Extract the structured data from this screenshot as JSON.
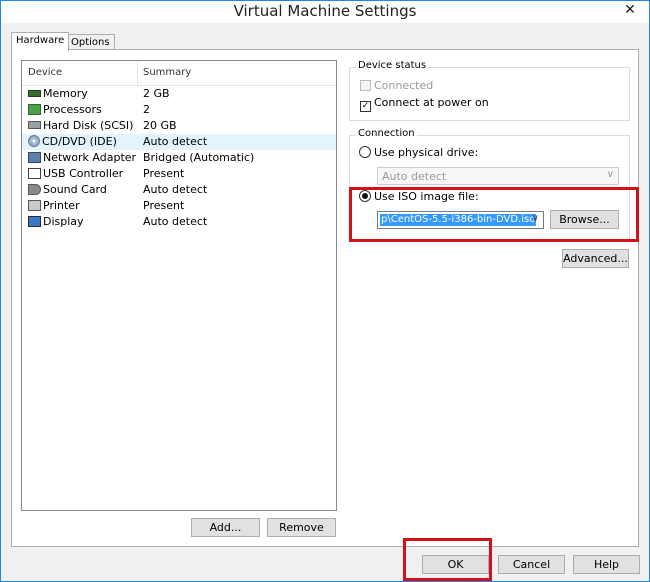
{
  "window": {
    "title": "Virtual Machine Settings",
    "close_glyph": "✕"
  },
  "tabs": [
    {
      "label": "Hardware"
    },
    {
      "label": "Options"
    }
  ],
  "device_list": {
    "columns": {
      "device": "Device",
      "summary": "Summary"
    },
    "rows": [
      {
        "icon": "memory-icon",
        "device": "Memory",
        "summary": "2 GB"
      },
      {
        "icon": "processor-icon",
        "device": "Processors",
        "summary": "2"
      },
      {
        "icon": "hard-disk-icon",
        "device": "Hard Disk (SCSI)",
        "summary": "20 GB"
      },
      {
        "icon": "cd-dvd-icon",
        "device": "CD/DVD (IDE)",
        "summary": "Auto detect",
        "selected": true
      },
      {
        "icon": "network-adapter-icon",
        "device": "Network Adapter",
        "summary": "Bridged (Automatic)"
      },
      {
        "icon": "usb-controller-icon",
        "device": "USB Controller",
        "summary": "Present"
      },
      {
        "icon": "sound-card-icon",
        "device": "Sound Card",
        "summary": "Auto detect"
      },
      {
        "icon": "printer-icon",
        "device": "Printer",
        "summary": "Present"
      },
      {
        "icon": "display-icon",
        "device": "Display",
        "summary": "Auto detect"
      }
    ]
  },
  "list_buttons": {
    "add": "Add...",
    "remove": "Remove"
  },
  "device_status": {
    "title": "Device status",
    "connected": {
      "label": "Connected",
      "checked": false,
      "enabled": false
    },
    "connect_at_power_on": {
      "label": "Connect at power on",
      "checked": true,
      "check_glyph": "✓"
    }
  },
  "connection": {
    "title": "Connection",
    "physical_drive": {
      "label": "Use physical drive:",
      "selected": false
    },
    "physical_drive_select": {
      "value": "Auto detect",
      "arrow": "∨"
    },
    "iso_image": {
      "label": "Use ISO image file:",
      "selected": true
    },
    "iso_path": {
      "value": "p\\CentOS-5.5-i386-bin-DVD.iso",
      "arrow": "∨"
    },
    "browse": "Browse..."
  },
  "advanced": "Advanced...",
  "footer": {
    "ok": "OK",
    "cancel": "Cancel",
    "help": "Help"
  },
  "colors": {
    "highlight": "#d0121b",
    "accent": "#3399ff",
    "selected_row": "#e5f3fb"
  }
}
